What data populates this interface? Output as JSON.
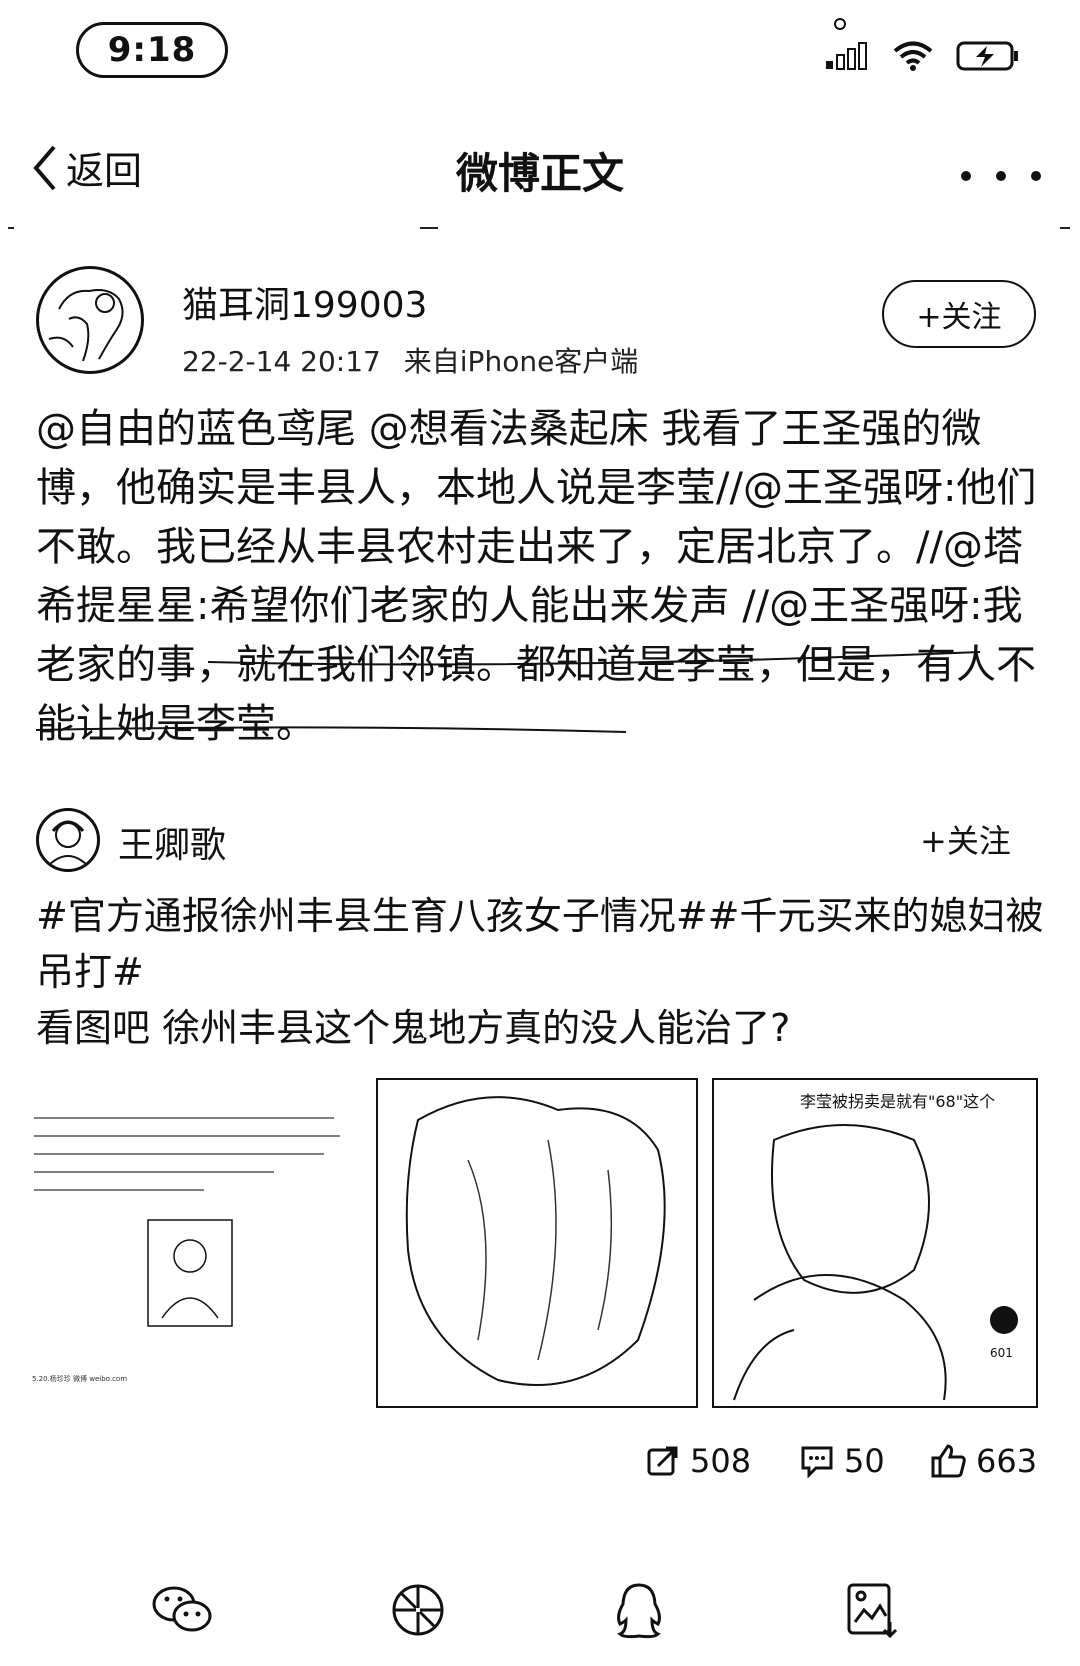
{
  "status_bar": {
    "time": "9:18"
  },
  "nav": {
    "back_label": "返回",
    "title": "微博正文"
  },
  "post": {
    "username": "猫耳洞199003",
    "time": "22-2-14 20:17",
    "source": "来自iPhone客户端",
    "follow_label": "+关注",
    "text": "@自由的蓝色鸢尾 @想看法桑起床 我看了王圣强的微博，他确实是丰县人，本地人说是李莹//@王圣强呀:他们不敢。我已经从丰县农村走出来了，定居北京了。//@塔希提星星:希望你们老家的人能出来发声 //@王圣强呀:我老家的事，就在我们邻镇。都知道是李莹，但是，有人不能让她是李莹。"
  },
  "retweet": {
    "username": "王卿歌",
    "follow_label": "+关注",
    "text_line1": "#官方通报徐州丰县生育八孩女子情况##千元买来的媳妇被吊打#",
    "text_line2": "看图吧 徐州丰县这个鬼地方真的没人能治了?",
    "image3_caption": "李莹被拐卖是就有\"68\"这个",
    "image3_badge": "601",
    "image1_watermark": "5.20.杨珍珍 微博 weibo.com"
  },
  "stats": {
    "reposts": "508",
    "comments": "50",
    "likes": "663"
  },
  "tabbar": {
    "icons": [
      "wechat-icon",
      "aperture-icon",
      "qq-icon",
      "save-image-icon"
    ]
  }
}
